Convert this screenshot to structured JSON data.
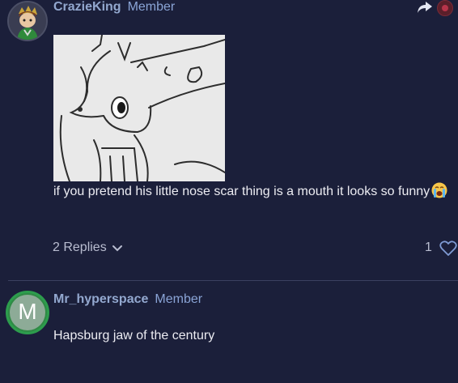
{
  "posts": [
    {
      "author": "CrazieKing",
      "role": "Member",
      "avatar_icon": "character-avatar",
      "image_icon": "sketch-drawing-image",
      "text": "if you pretend his little nose scar thing is a mouth it looks so funny",
      "emoji_icon": "crying-face-emoji",
      "replies_label": "2 Replies",
      "like_count": "1"
    },
    {
      "author": "Mr_hyperspace",
      "role": "Member",
      "avatar_letter": "M",
      "text": "Hapsburg jaw of the century"
    }
  ],
  "colors": {
    "background": "#1b1f3a",
    "username": "#93a8cf",
    "role": "#8aa4d6",
    "muted": "#b9bdd0",
    "like_heart": "#7f9bd4"
  }
}
